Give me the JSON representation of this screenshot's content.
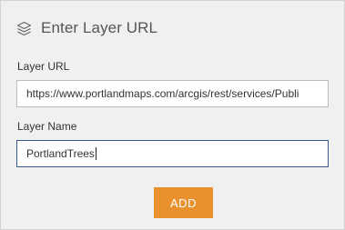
{
  "dialog": {
    "title": "Enter Layer URL",
    "header_icon": "layers-icon"
  },
  "form": {
    "layer_url": {
      "label": "Layer URL",
      "value": "https://www.portlandmaps.com/arcgis/rest/services/Publi"
    },
    "layer_name": {
      "label": "Layer Name",
      "value": "PortlandTrees"
    },
    "add_button_label": "ADD"
  },
  "colors": {
    "panel_background": "#f0f0f0",
    "accent_button": "#e8912d",
    "focused_field_border": "#3a5a8a"
  }
}
